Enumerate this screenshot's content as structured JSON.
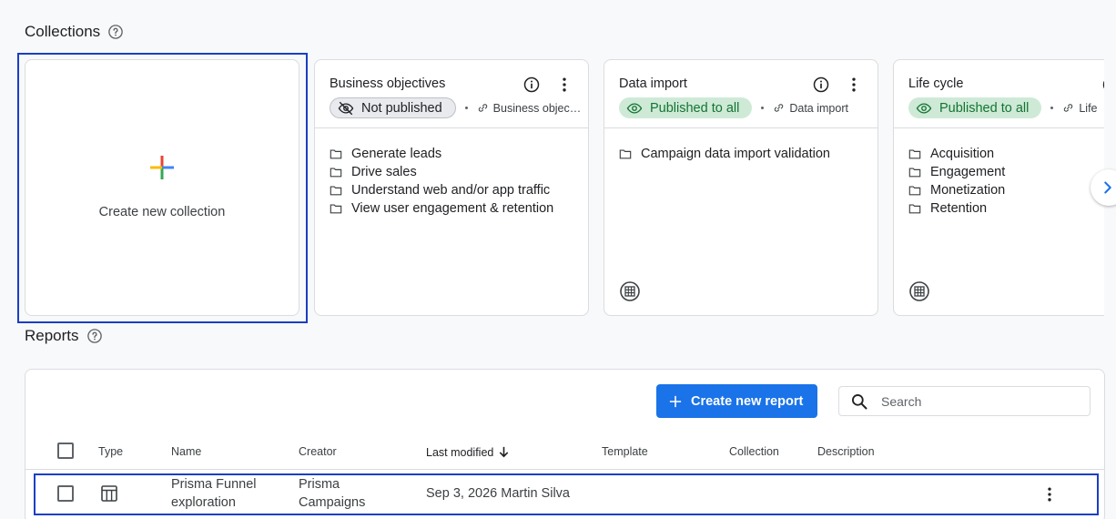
{
  "collections": {
    "title": "Collections",
    "help_icon": "help-circle-icon",
    "create_card": {
      "label": "Create new collection",
      "icon": "multicolor-plus-icon"
    },
    "cards": [
      {
        "title": "Business objectives",
        "status": "Not published",
        "status_icon": "eye-off-icon",
        "template": "Business objec…",
        "items": [
          "Generate leads",
          "Drive sales",
          "Understand web and/or app traffic",
          "View user engagement & retention"
        ]
      },
      {
        "title": "Data import",
        "status": "Published to all",
        "status_icon": "eye-icon",
        "template": "Data import",
        "items": [
          "Campaign data import validation"
        ]
      },
      {
        "title": "Life cycle",
        "status": "Published to all",
        "status_icon": "eye-icon",
        "template": "Life",
        "items": [
          "Acquisition",
          "Engagement",
          "Monetization",
          "Retention"
        ]
      }
    ]
  },
  "reports": {
    "title": "Reports",
    "create_button": "Create new report",
    "search_placeholder": "Search",
    "columns": {
      "type": "Type",
      "name": "Name",
      "creator": "Creator",
      "last_modified": "Last modified",
      "template": "Template",
      "collection": "Collection",
      "description": "Description"
    },
    "rows": [
      {
        "name_line1": "Prisma Funnel",
        "name_line2": "exploration",
        "creator_line1": "Prisma",
        "creator_line2": "Campaigns",
        "last_modified": "Sep 3, 2026 Martin Silva",
        "template": "",
        "collection": "",
        "description": ""
      }
    ]
  },
  "colors": {
    "primary": "#1a73e8",
    "published_bg": "#ceead6",
    "published_text": "#137333",
    "focus_outline": "#1a3fc4"
  }
}
